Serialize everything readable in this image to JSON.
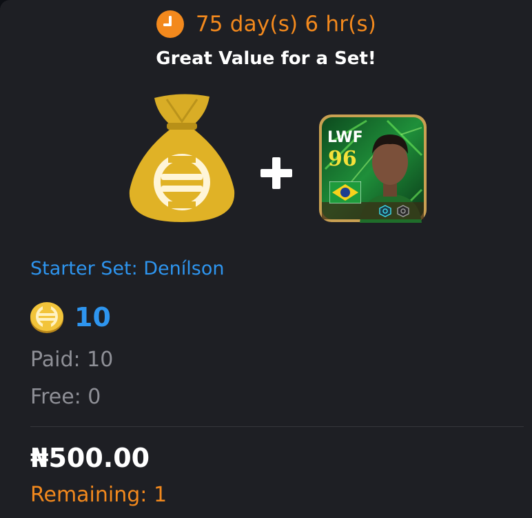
{
  "offer": {
    "timer": {
      "icon": "clock-icon",
      "text": "75 day(s) 6 hr(s)",
      "color": "#f3891d"
    },
    "subtitle": "Great Value for a Set!",
    "bundle_items": [
      {
        "icon": "coin-bag-icon"
      },
      {
        "icon": "plus-icon"
      },
      {
        "icon": "player-card",
        "position": "LWF",
        "rating": "96",
        "nationality_flag": "brazil-flag-icon"
      }
    ],
    "set_name": "Starter Set: Denílson",
    "coin_price": {
      "icon": "ecoin-icon",
      "amount": "10",
      "color": "#2e95ef"
    },
    "paid": "Paid: 10",
    "free": "Free: 0",
    "real_price": "₦500.00",
    "remaining": "Remaining: 1",
    "accent_color": "#f3891d",
    "background_color": "#1e1f24"
  }
}
